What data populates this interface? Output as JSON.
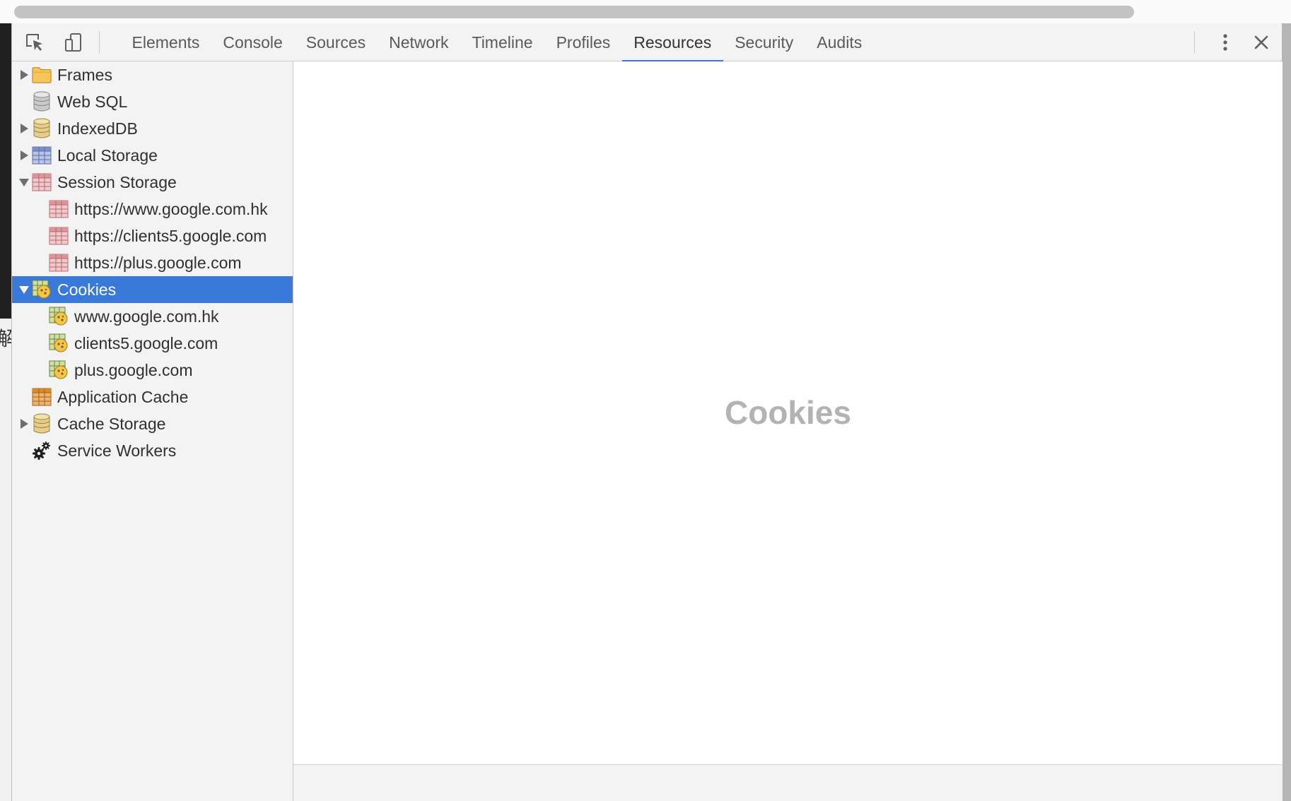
{
  "toolbar": {
    "tabs": [
      {
        "label": "Elements"
      },
      {
        "label": "Console"
      },
      {
        "label": "Sources"
      },
      {
        "label": "Network"
      },
      {
        "label": "Timeline"
      },
      {
        "label": "Profiles"
      },
      {
        "label": "Resources",
        "active": true
      },
      {
        "label": "Security"
      },
      {
        "label": "Audits"
      }
    ],
    "icons": [
      "inspect-element-icon",
      "device-mode-icon",
      "more-options-icon",
      "close-icon"
    ]
  },
  "background_page": {
    "fragment_char": "解"
  },
  "sidebar": {
    "items": [
      {
        "label": "Frames",
        "icon": "folder-icon",
        "expander": "collapsed"
      },
      {
        "label": "Web SQL",
        "icon": "database-icon",
        "expander": "none"
      },
      {
        "label": "IndexedDB",
        "icon": "database-gold-icon",
        "expander": "collapsed"
      },
      {
        "label": "Local Storage",
        "icon": "blue-table-icon",
        "expander": "collapsed"
      },
      {
        "label": "Session Storage",
        "icon": "red-table-icon",
        "expander": "expanded",
        "children": [
          {
            "label": "https://www.google.com.hk",
            "icon": "red-table-icon"
          },
          {
            "label": "https://clients5.google.com",
            "icon": "red-table-icon"
          },
          {
            "label": "https://plus.google.com",
            "icon": "red-table-icon"
          }
        ]
      },
      {
        "label": "Cookies",
        "icon": "cookie-icon",
        "expander": "expanded",
        "selected": true,
        "children": [
          {
            "label": "www.google.com.hk",
            "icon": "cookie-icon"
          },
          {
            "label": "clients5.google.com",
            "icon": "cookie-icon"
          },
          {
            "label": "plus.google.com",
            "icon": "cookie-icon"
          }
        ]
      },
      {
        "label": "Application Cache",
        "icon": "orange-table-icon",
        "expander": "none"
      },
      {
        "label": "Cache Storage",
        "icon": "database-gold-icon",
        "expander": "collapsed"
      },
      {
        "label": "Service Workers",
        "icon": "gears-icon",
        "expander": "none"
      }
    ]
  },
  "main": {
    "title": "Cookies"
  },
  "colors": {
    "selection": "#3879d9",
    "active_tab_underline": "#3d78d8",
    "placeholder_title": "#b3b3b3",
    "panel_background": "#f3f3f3"
  }
}
